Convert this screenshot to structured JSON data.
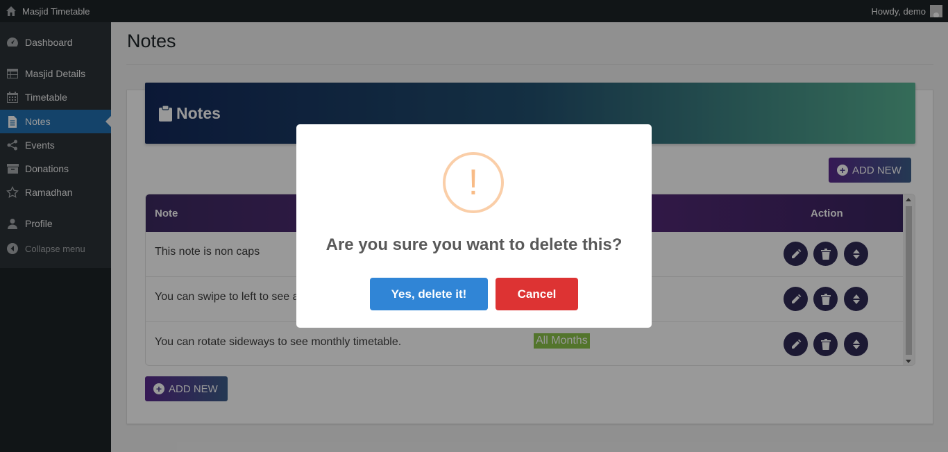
{
  "adminbar": {
    "site_title": "Masjid Timetable",
    "howdy": "Howdy, demo"
  },
  "sidebar": {
    "items": [
      {
        "label": "Dashboard",
        "icon": "dashboard-icon"
      },
      {
        "label": "Masjid Details",
        "icon": "table-icon"
      },
      {
        "label": "Timetable",
        "icon": "calendar-icon"
      },
      {
        "label": "Notes",
        "icon": "page-icon",
        "active": true
      },
      {
        "label": "Events",
        "icon": "share-icon"
      },
      {
        "label": "Donations",
        "icon": "archive-icon"
      },
      {
        "label": "Ramadhan",
        "icon": "star-icon"
      },
      {
        "label": "Profile",
        "icon": "user-icon"
      }
    ],
    "collapse_label": "Collapse menu"
  },
  "page": {
    "title": "Notes",
    "hero_title": "Notes",
    "add_new_label": "ADD NEW"
  },
  "table": {
    "headers": {
      "note": "Note",
      "action": "Action"
    },
    "rows": [
      {
        "note": "This note is non caps",
        "badge": ""
      },
      {
        "note": "You can swipe to left to see a",
        "badge": ""
      },
      {
        "note": "You can rotate sideways to see monthly timetable.",
        "badge": "All Months"
      }
    ]
  },
  "colors": {
    "accent": "#2271b1",
    "confirm": "#3085d6",
    "cancel": "#dd3333",
    "badge": "#8bc34a"
  },
  "modal": {
    "title": "Are you sure you want to delete this?",
    "icon": "!",
    "confirm_label": "Yes, delete it!",
    "cancel_label": "Cancel"
  }
}
